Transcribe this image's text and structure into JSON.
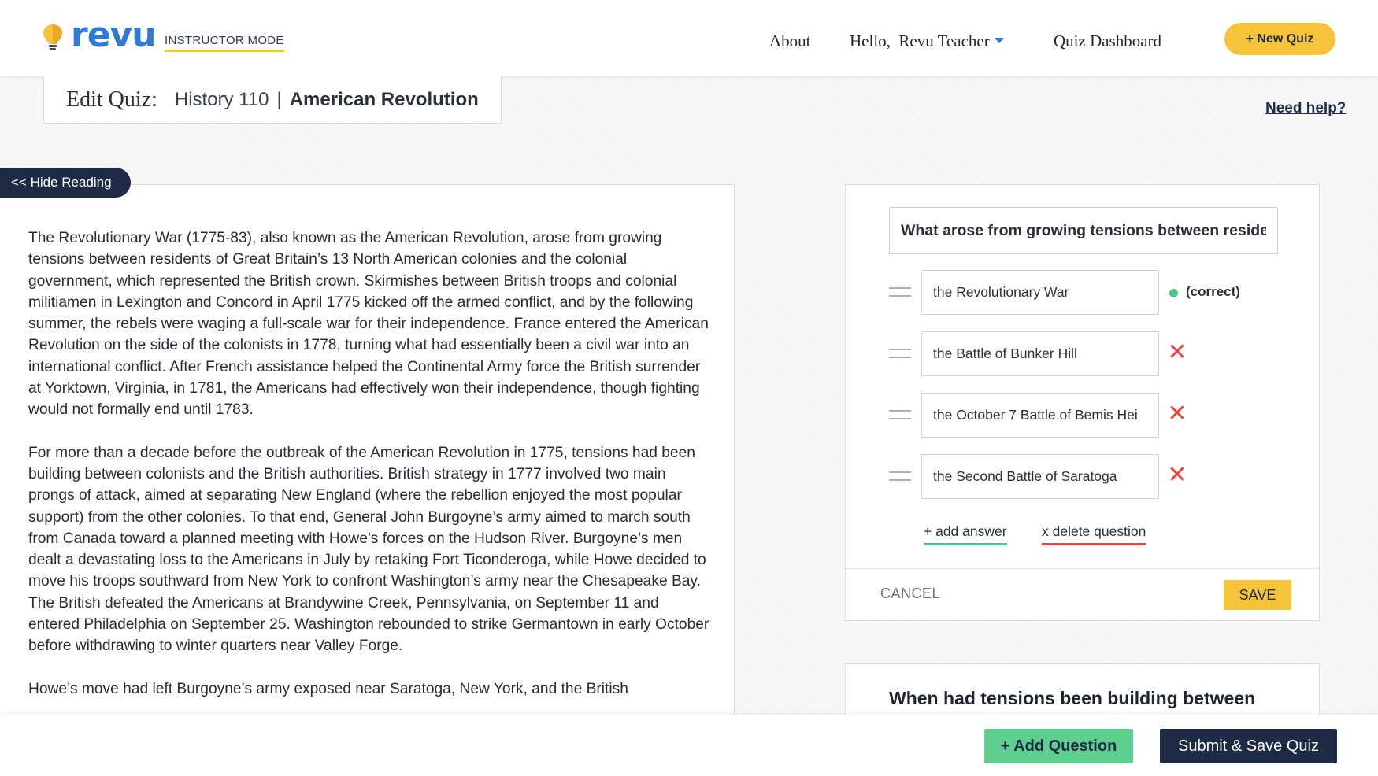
{
  "header": {
    "brand": "revu",
    "mode": "INSTRUCTOR MODE",
    "nav": {
      "about": "About",
      "hello": "Hello,  Revu Teacher",
      "dashboard": "Quiz Dashboard"
    },
    "new_quiz": "+ New Quiz"
  },
  "title": {
    "prefix": "Edit Quiz:",
    "course": "History 110",
    "separator": "|",
    "topic": "American Revolution"
  },
  "help": "Need help?",
  "reading": {
    "toggle": "<< Hide Reading",
    "paragraphs": [
      "The Revolutionary War (1775-83), also known as the American Revolution, arose from growing tensions between residents of Great Britain’s 13 North American colonies and the colonial government, which represented the British crown. Skirmishes between British troops and colonial militiamen in Lexington and Concord in April 1775 kicked off the armed conflict, and by the following summer, the rebels were waging a full-scale war for their independence. France entered the American Revolution on the side of the colonists in 1778, turning what had essentially been a civil war into an international conflict. After French assistance helped the Continental Army force the British surrender at Yorktown, Virginia, in 1781, the Americans had effectively won their independence, though fighting would not formally end until 1783.",
      "For more than a decade before the outbreak of the American Revolution in 1775, tensions had been building between colonists and the British authorities. British strategy in 1777 involved two main prongs of attack, aimed at separating New England (where the rebellion enjoyed the most popular support) from the other colonies. To that end, General John Burgoyne’s army aimed to march south from Canada toward a planned meeting with Howe’s forces on the Hudson River. Burgoyne’s men dealt a devastating loss to the Americans in July by retaking Fort Ticonderoga, while Howe decided to move his troops southward from New York to confront Washington’s army near the Chesapeake Bay. The British defeated the Americans at Brandywine Creek, Pennsylvania, on September 11 and entered Philadelphia on September 25. Washington rebounded to strike Germantown in early October before withdrawing to winter quarters near Valley Forge.",
      "Howe’s move had left Burgoyne’s army exposed near Saratoga, New York, and the British"
    ]
  },
  "editor": {
    "question": "What arose from growing tensions between reside",
    "answers": [
      {
        "text": "the Revolutionary War",
        "correct": true
      },
      {
        "text": "the Battle of Bunker Hill",
        "correct": false
      },
      {
        "text": "the October 7 Battle of Bemis Hei",
        "correct": false
      },
      {
        "text": "the Second Battle of Saratoga",
        "correct": false
      }
    ],
    "correct_label": "(correct)",
    "remove_glyph": "✕",
    "add_answer": "+ add answer",
    "delete_question": "x delete question",
    "cancel": "CANCEL",
    "save": "SAVE"
  },
  "next_question": "When had tensions been building between",
  "footer": {
    "add_question": "+ Add Question",
    "submit": "Submit & Save Quiz"
  },
  "colors": {
    "brand_blue": "#2e7ad6",
    "accent_yellow": "#f6c43b",
    "navy": "#1f2a44",
    "green": "#5ecf8f",
    "red": "#e8463c"
  }
}
